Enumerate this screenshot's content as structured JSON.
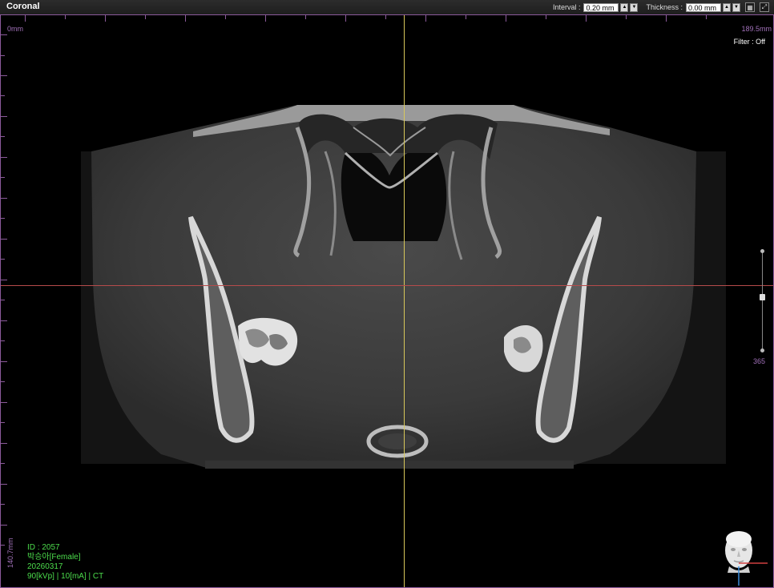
{
  "view": {
    "title": "Coronal"
  },
  "toolbar": {
    "interval_label": "Interval :",
    "interval_value": "0.20 mm",
    "thickness_label": "Thickness :",
    "thickness_value": "0.00 mm"
  },
  "overlay": {
    "top_left_scale": "0mm",
    "top_right_scale": "189.5mm",
    "filter_status": "Filter : Off",
    "left_scale": "140.7mm",
    "slice_number": "365"
  },
  "patient": {
    "id_line": "ID : 2057",
    "name_line": "박승아[Female]",
    "date_line": "20260317",
    "scan_params": "90[kVp] | 10[mA] | CT"
  },
  "colors": {
    "border": "#8b5a9b",
    "vertical_crosshair": "#d8c85a",
    "horizontal_crosshair": "#b64b4b",
    "patient_info": "#4cdc4c"
  },
  "icons": {
    "layout": "grid-icon",
    "expand": "expand-icon",
    "orientation": "head-orientation-icon"
  }
}
